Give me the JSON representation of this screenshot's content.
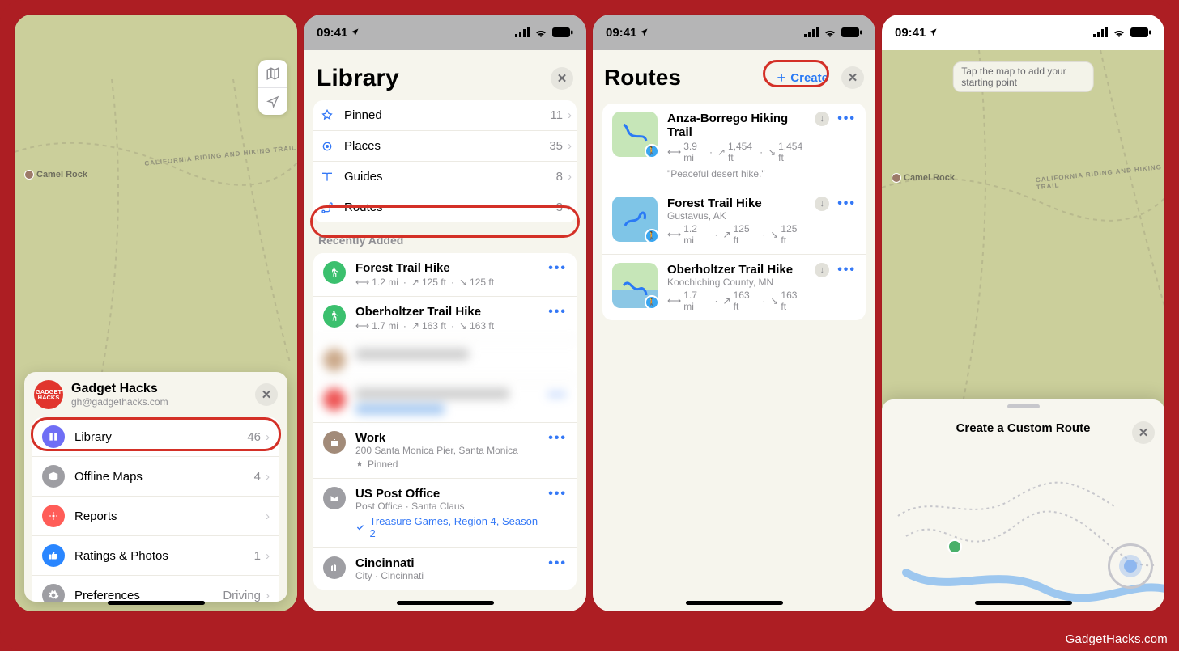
{
  "watermark": "GadgetHacks.com",
  "status": {
    "time": "09:41"
  },
  "map_labels": {
    "camel_rock": "Camel Rock",
    "trail_name": "CALIFORNIA RIDING AND HIKING TRAIL"
  },
  "phone1": {
    "profile": {
      "name": "Gadget Hacks",
      "email": "gh@gadgethacks.com",
      "avatar_text": "GADGET HACKS"
    },
    "menu": {
      "library": {
        "label": "Library",
        "count": "46"
      },
      "offline": {
        "label": "Offline Maps",
        "count": "4"
      },
      "reports": {
        "label": "Reports"
      },
      "ratings": {
        "label": "Ratings & Photos",
        "count": "1"
      },
      "preferences": {
        "label": "Preferences",
        "value": "Driving"
      }
    }
  },
  "phone2": {
    "title": "Library",
    "categories": {
      "pinned": {
        "label": "Pinned",
        "count": "11"
      },
      "places": {
        "label": "Places",
        "count": "35"
      },
      "guides": {
        "label": "Guides",
        "count": "8"
      },
      "routes": {
        "label": "Routes",
        "count": "3"
      }
    },
    "recently_added_title": "Recently Added",
    "recent": [
      {
        "title": "Forest Trail Hike",
        "dist": "1.2 mi",
        "ascent": "125 ft",
        "descent": "125 ft"
      },
      {
        "title": "Oberholtzer Trail Hike",
        "dist": "1.7 mi",
        "ascent": "163 ft",
        "descent": "163 ft"
      }
    ],
    "work": {
      "title": "Work",
      "sub": "200 Santa Monica Pier, Santa Monica",
      "pinned": "Pinned"
    },
    "uspo": {
      "title": "US Post Office",
      "sub": "Post Office · Santa Claus",
      "treasure": "Treasure Games, Region 4, Season 2"
    },
    "cincinnati": {
      "title": "Cincinnati",
      "sub": "City · Cincinnati"
    }
  },
  "phone3": {
    "title": "Routes",
    "create": "Create",
    "routes": [
      {
        "title": "Anza-Borrego Hiking Trail",
        "dist": "3.9 mi",
        "ascent": "1,454 ft",
        "descent": "1,454 ft",
        "quote": "\"Peaceful desert hike.\""
      },
      {
        "title": "Forest Trail Hike",
        "sub": "Gustavus, AK",
        "dist": "1.2 mi",
        "ascent": "125 ft",
        "descent": "125 ft"
      },
      {
        "title": "Oberholtzer Trail Hike",
        "sub": "Koochiching County, MN",
        "dist": "1.7 mi",
        "ascent": "163 ft",
        "descent": "163 ft"
      }
    ]
  },
  "phone4": {
    "hint": "Tap the map to add your starting point",
    "sheet_title": "Create a Custom Route"
  }
}
